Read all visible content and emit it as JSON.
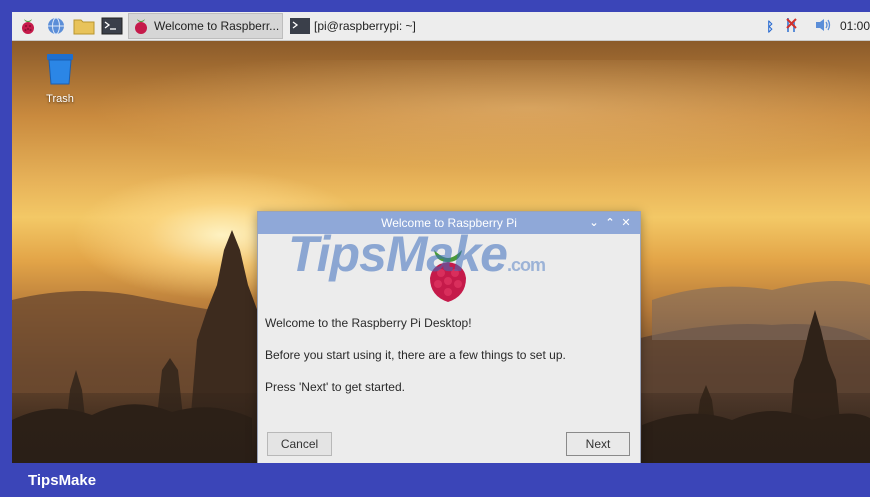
{
  "taskbar": {
    "active_task_label": "Welcome to Raspberr...",
    "terminal_task_label": "[pi@raspberrypi: ~]",
    "clock": "01:00"
  },
  "desktop": {
    "trash_label": "Trash"
  },
  "dialog": {
    "title": "Welcome to Raspberry Pi",
    "line1": "Welcome to the Raspberry Pi Desktop!",
    "line2": "Before you start using it, there are a few things to set up.",
    "line3": "Press 'Next' to get started.",
    "cancel_label": "Cancel",
    "next_label": "Next"
  },
  "watermark": {
    "text": "TipsMake",
    "suffix": ".com"
  },
  "brand": "TipsMake",
  "colors": {
    "frame": "#3b45b8",
    "titlebar": "#8fa8d8",
    "raspberry": "#c51a4a"
  }
}
